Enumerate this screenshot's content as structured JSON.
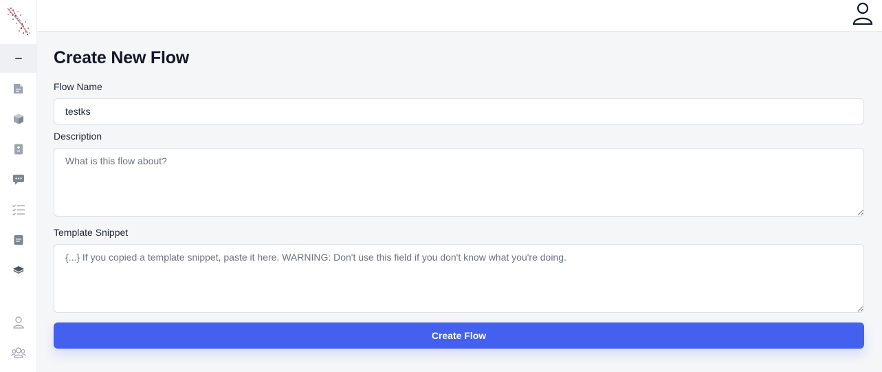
{
  "app": {
    "logo_icon": "splash-logo-icon"
  },
  "sidebar": {
    "collapse_icon": "minus-icon",
    "items": [
      {
        "icon": "file-icon"
      },
      {
        "icon": "cube-icon"
      },
      {
        "icon": "calculator-icon"
      },
      {
        "icon": "chat-bubble-icon"
      },
      {
        "icon": "checklist-icon"
      },
      {
        "icon": "note-icon"
      },
      {
        "icon": "layers-icon"
      },
      {
        "icon": "user-icon"
      },
      {
        "icon": "users-icon"
      }
    ]
  },
  "header": {
    "profile_icon": "user-profile-icon"
  },
  "page": {
    "title": "Create New Flow"
  },
  "form": {
    "flow_name": {
      "label": "Flow Name",
      "value": "testks"
    },
    "description": {
      "label": "Description",
      "placeholder": "What is this flow about?",
      "value": ""
    },
    "template_snippet": {
      "label": "Template Snippet",
      "placeholder": "{...} If you copied a template snippet, paste it here. WARNING: Don't use this field if you don't know what you're doing.",
      "value": ""
    },
    "submit_label": "Create Flow"
  },
  "colors": {
    "primary": "#4361ee",
    "sidebar_icon": "#9ca3af",
    "sidebar_active_bg": "#eef0f3",
    "page_bg": "#f5f6f8",
    "logo_red": "#d11f2a"
  }
}
